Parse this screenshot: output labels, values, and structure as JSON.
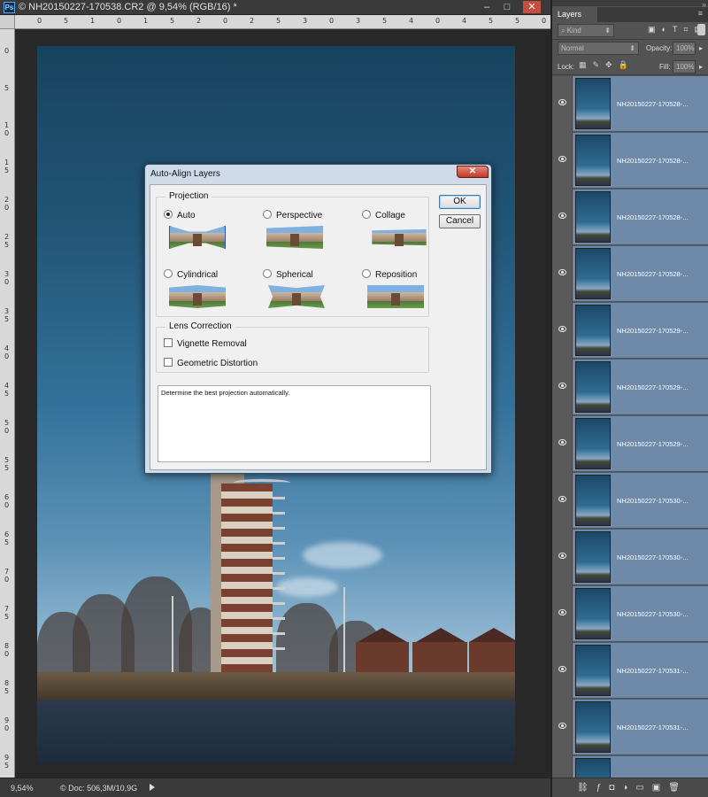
{
  "app": {
    "document_title": "© NH20150227-170538.CR2 @ 9,54% (RGB/16) *",
    "window_controls": [
      "–",
      "□",
      "✕"
    ]
  },
  "statusbar": {
    "zoom": "9,54%",
    "doc_info": "© Doc: 506,3M/10,9G"
  },
  "ruler": {
    "top_labels": [
      "0",
      "5",
      "1",
      "0",
      "1",
      "5",
      "2",
      "0",
      "2",
      "5",
      "3",
      "0",
      "3",
      "5",
      "4",
      "0",
      "4",
      "5",
      "5",
      "0"
    ],
    "left_labels": [
      "0",
      "5",
      "1\n0",
      "1\n5",
      "2\n0",
      "2\n5",
      "3\n0",
      "3\n5",
      "4\n0",
      "4\n5",
      "5\n0",
      "5\n5",
      "6\n0",
      "6\n5",
      "7\n0",
      "7\n5",
      "8\n0",
      "8\n5",
      "9\n0",
      "9\n5"
    ]
  },
  "layers_panel": {
    "tab_label": "Layers",
    "kind_label": "Kind",
    "blend_mode": "Normal",
    "opacity_label": "Opacity:",
    "opacity_value": "100%",
    "lock_label": "Lock:",
    "fill_label": "Fill:",
    "fill_value": "100%",
    "layers": [
      "NH20150227-170528-...",
      "NH20150227-170528-...",
      "NH20150227-170528-...",
      "NH20150227-170528-...",
      "NH20150227-170529-...",
      "NH20150227-170529-...",
      "NH20150227-170529-...",
      "NH20150227-170530-...",
      "NH20150227-170530-...",
      "NH20150227-170530-...",
      "NH20150227-170531-...",
      "NH20150227-170531-...",
      ""
    ]
  },
  "dialog": {
    "title": "Auto-Align Layers",
    "close_label": "✕",
    "projection_title": "Projection",
    "projection_options": [
      {
        "label": "Auto",
        "checked": true
      },
      {
        "label": "Perspective",
        "checked": false
      },
      {
        "label": "Collage",
        "checked": false
      },
      {
        "label": "Cylindrical",
        "checked": false
      },
      {
        "label": "Spherical",
        "checked": false
      },
      {
        "label": "Reposition",
        "checked": false
      }
    ],
    "lens_title": "Lens Correction",
    "lens_options": [
      {
        "label": "Vignette Removal",
        "checked": false
      },
      {
        "label": "Geometric Distortion",
        "checked": false
      }
    ],
    "ok_label": "OK",
    "cancel_label": "Cancel",
    "description": "Determine the best projection automatically."
  }
}
